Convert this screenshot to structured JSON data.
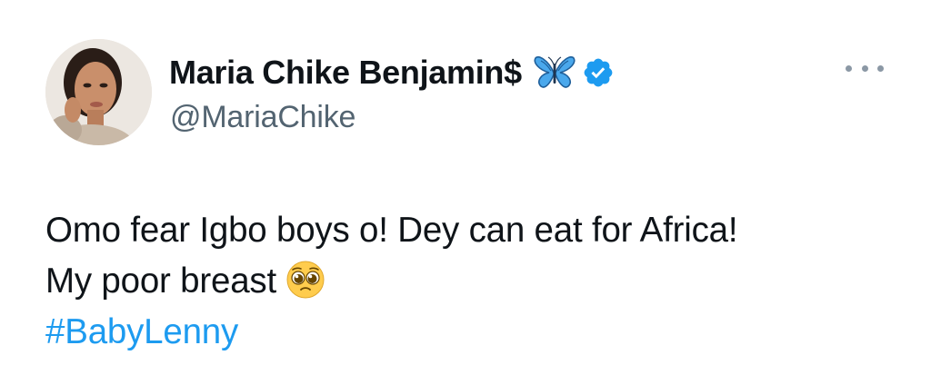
{
  "author": {
    "display_name": "Maria Chike Benjamin$",
    "handle": "@MariaChike",
    "verified": true,
    "icons": [
      "butterfly-icon",
      "verified-badge-icon"
    ]
  },
  "tweet": {
    "line1": "Omo fear Igbo boys o! Dey can eat for Africa!",
    "line2": "My poor breast",
    "line2_emoji": "pleading-face-emoji",
    "hashtag": "#BabyLenny"
  },
  "colors": {
    "text": "#0f1419",
    "secondary": "#536471",
    "accent": "#1d9bf0",
    "butterfly": "#4aa8ec"
  }
}
